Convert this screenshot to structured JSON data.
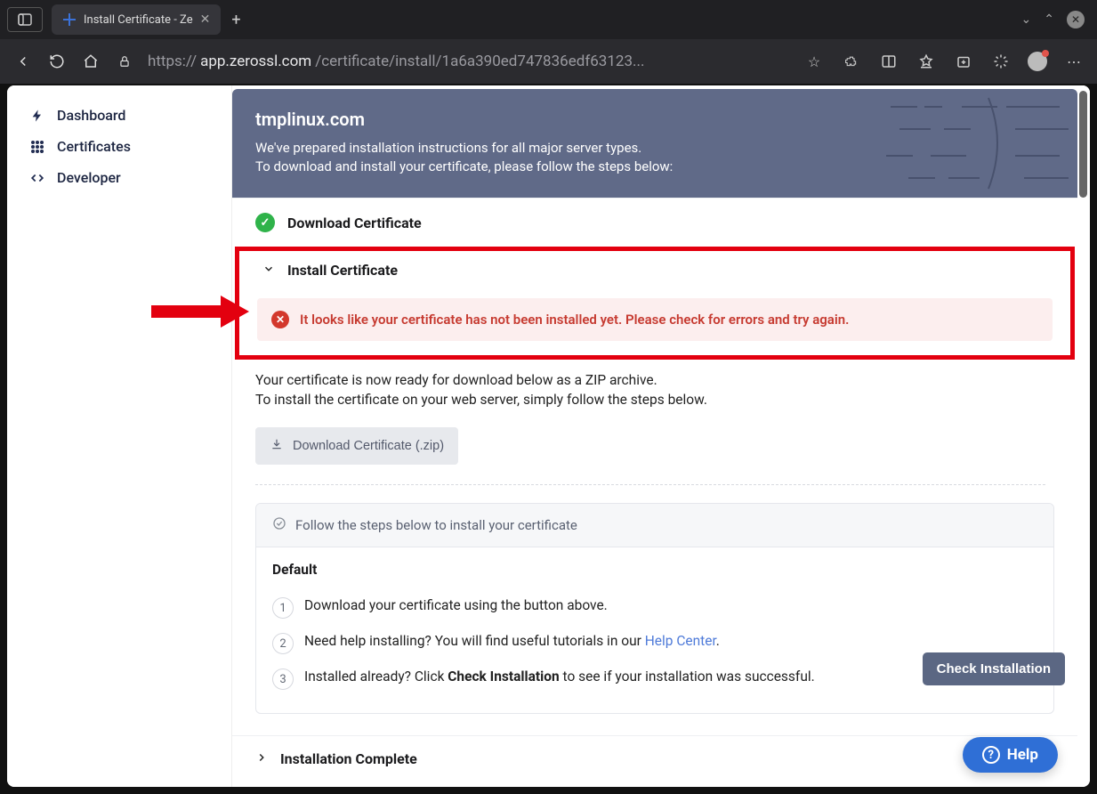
{
  "browser": {
    "tab_title": "Install Certificate - Ze",
    "url_prefix": "https://",
    "url_host": "app.zerossl.com",
    "url_path": "/certificate/install/1a6a390ed747836edf63123...",
    "chevron_down": "⌄",
    "chevron_up": "⌃",
    "close_glyph": "✕",
    "new_tab_glyph": "+"
  },
  "sidebar": {
    "items": [
      {
        "label": "Dashboard"
      },
      {
        "label": "Certificates"
      },
      {
        "label": "Developer"
      }
    ]
  },
  "header": {
    "domain": "tmplinux.com",
    "line1": "We've prepared installation instructions for all major server types.",
    "line2": "To download and install your certificate, please follow the steps below:"
  },
  "sections": {
    "download": "Download Certificate",
    "install": "Install Certificate",
    "complete": "Installation Complete"
  },
  "alert": {
    "message": "It looks like your certificate has not been installed yet. Please check for errors and try again."
  },
  "install_body": {
    "p1": "Your certificate is now ready for download below as a ZIP archive.",
    "p2": "To install the certificate on your web server, simply follow the steps below.",
    "download_button": "Download Certificate (.zip)"
  },
  "steps": {
    "heading": "Follow the steps below to install your certificate",
    "group_title": "Default",
    "rows": [
      {
        "n": "1",
        "text": "Download your certificate using the button above."
      },
      {
        "n": "2",
        "text_a": "Need help installing? You will find useful tutorials in our ",
        "link": "Help Center",
        "text_b": "."
      },
      {
        "n": "3",
        "text_a": "Installed already? Click ",
        "bold": "Check Installation",
        "text_b": " to see if your installation was successful."
      }
    ]
  },
  "buttons": {
    "check_installation": "Check Installation",
    "help_fab": "Help"
  }
}
